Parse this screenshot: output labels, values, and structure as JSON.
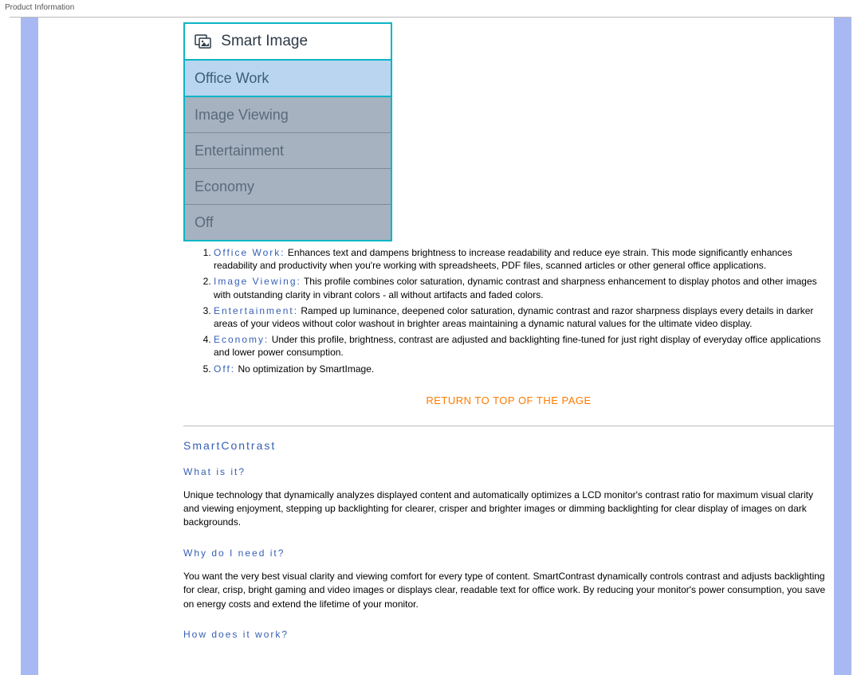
{
  "header": {
    "page_label": "Product Information"
  },
  "osd": {
    "title": "Smart Image",
    "items": [
      {
        "label": "Office Work",
        "selected": true
      },
      {
        "label": "Image Viewing",
        "selected": false
      },
      {
        "label": "Entertainment",
        "selected": false
      },
      {
        "label": "Economy",
        "selected": false
      },
      {
        "label": "Off",
        "selected": false
      }
    ]
  },
  "modes": [
    {
      "label": "Office Work:",
      "text": " Enhances text and dampens brightness to increase readability and reduce eye strain. This mode significantly enhances readability and productivity when you're working with spreadsheets, PDF files, scanned articles or other general office applications."
    },
    {
      "label": "Image Viewing:",
      "text": " This profile combines color saturation, dynamic contrast and sharpness enhancement to display photos and other images with outstanding clarity in vibrant colors - all without artifacts and faded colors."
    },
    {
      "label": "Entertainment:",
      "text": " Ramped up luminance, deepened color saturation, dynamic contrast and razor sharpness displays every details in darker areas of your videos without color washout in brighter areas maintaining a dynamic natural values for the ultimate video display."
    },
    {
      "label": "Economy:",
      "text": " Under this profile, brightness, contrast are adjusted and backlighting fine-tuned for just right display of everyday office applications and lower power consumption."
    },
    {
      "label": "Off:",
      "text": " No optimization by SmartImage."
    }
  ],
  "return_link": "RETURN TO TOP OF THE PAGE",
  "smartcontrast": {
    "title": "SmartContrast",
    "q1": "What is it?",
    "a1": "Unique technology that dynamically analyzes displayed content and automatically optimizes a LCD monitor's contrast ratio for maximum visual clarity and viewing enjoyment, stepping up backlighting for clearer, crisper and brighter images or dimming backlighting for clear display of images on dark backgrounds.",
    "q2": "Why do I need it?",
    "a2": "You want the very best visual clarity and viewing comfort for every type of content. SmartContrast dynamically controls contrast and adjusts backlighting for clear, crisp, bright gaming and video images or displays clear, readable text for office work. By reducing your monitor's power consumption, you save on energy costs and extend the lifetime of your monitor.",
    "q3": "How does it work?"
  }
}
